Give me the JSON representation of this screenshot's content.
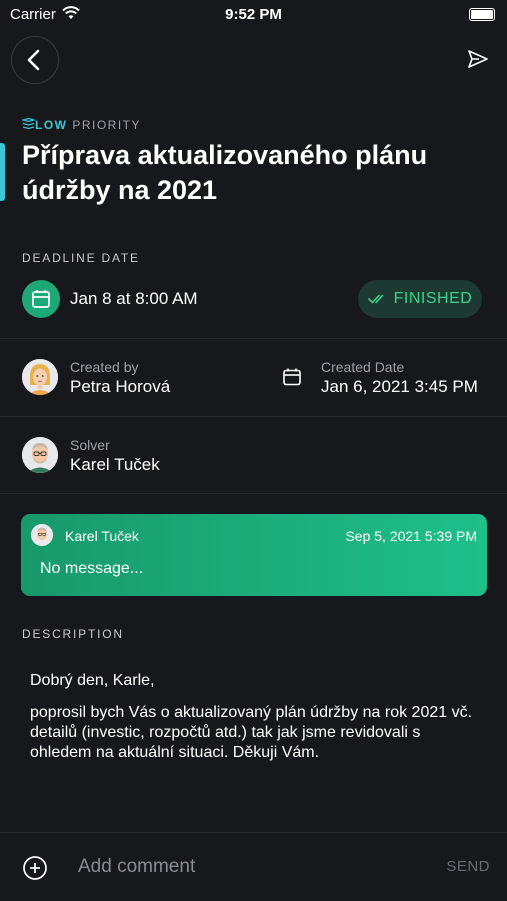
{
  "status_bar": {
    "carrier": "Carrier",
    "time": "9:52 PM"
  },
  "header": {
    "priority_level": "LOW",
    "priority_label": "PRIORITY",
    "title": "Příprava aktualizovaného plánu údržby na 2021"
  },
  "deadline": {
    "section_label": "DEADLINE DATE",
    "value": "Jan 8 at 8:00 AM",
    "status": "FINISHED"
  },
  "created": {
    "label": "Created by",
    "name": "Petra Horová",
    "date_label": "Created Date",
    "date": "Jan 6, 2021 3:45 PM"
  },
  "solver": {
    "label": "Solver",
    "name": "Karel Tuček"
  },
  "message": {
    "author": "Karel Tuček",
    "date": "Sep 5, 2021 5:39 PM",
    "text": "No message..."
  },
  "description": {
    "section_label": "DESCRIPTION",
    "greeting": "Dobrý den, Karle,",
    "body": "poprosil bych Vás o aktualizovaný plán údržby na rok 2021 vč. detailů (investic, rozpočtů atd.) tak jak jsme revidovali s ohledem na aktuální situaci. Děkuji Vám."
  },
  "comment": {
    "placeholder": "Add comment",
    "send_label": "SEND"
  },
  "colors": {
    "accent": "#3ac7d6",
    "success": "#1fa877",
    "background": "#17181b"
  },
  "icons": [
    "wifi-icon",
    "battery-icon",
    "back-icon",
    "send-icon",
    "priority-icon",
    "calendar-icon",
    "check-icon",
    "add-icon"
  ]
}
